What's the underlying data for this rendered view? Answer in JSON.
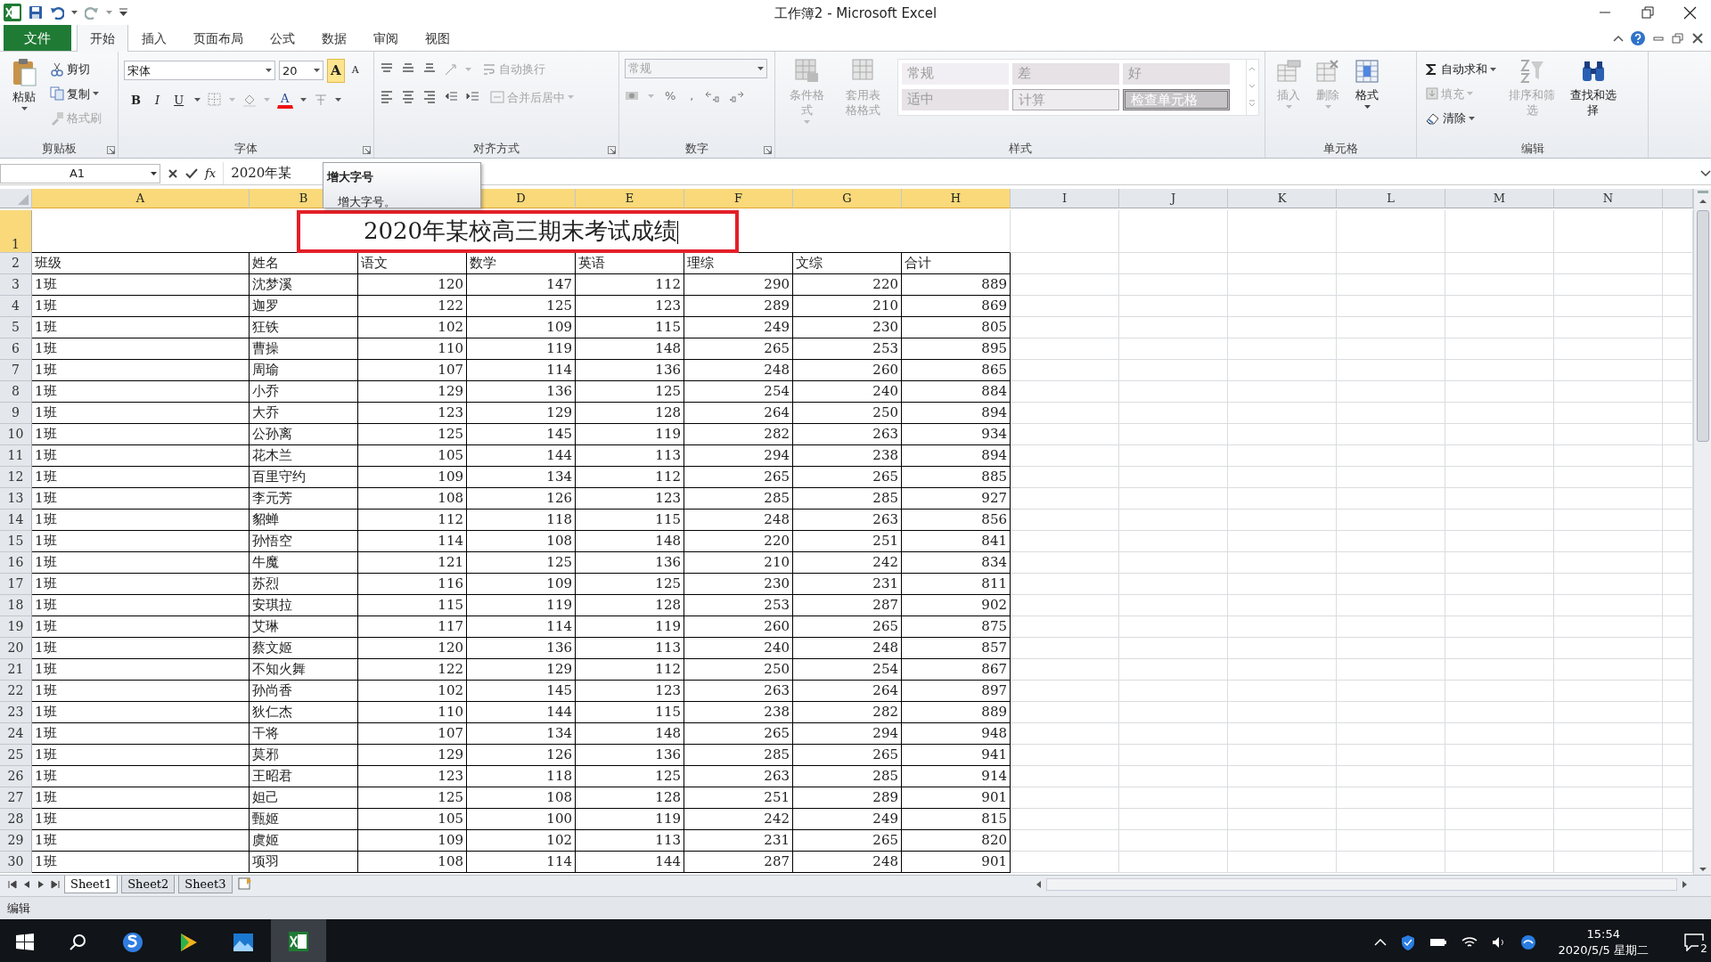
{
  "window": {
    "title": "工作簿2 - Microsoft Excel"
  },
  "ribbon_tabs": [
    {
      "label": "文件",
      "kind": "file",
      "selected": false
    },
    {
      "label": "开始",
      "kind": "tab",
      "selected": true
    },
    {
      "label": "插入",
      "kind": "tab",
      "selected": false
    },
    {
      "label": "页面布局",
      "kind": "tab",
      "selected": false
    },
    {
      "label": "公式",
      "kind": "tab",
      "selected": false
    },
    {
      "label": "数据",
      "kind": "tab",
      "selected": false
    },
    {
      "label": "审阅",
      "kind": "tab",
      "selected": false
    },
    {
      "label": "视图",
      "kind": "tab",
      "selected": false
    }
  ],
  "ribbon": {
    "groups": [
      {
        "kind": "clipboard",
        "label": "剪贴板",
        "launcher": true,
        "buttons": [
          {
            "label": "粘贴",
            "disabled": false
          },
          {
            "label": "剪切",
            "disabled": false
          },
          {
            "label": "复制",
            "disabled": false
          },
          {
            "label": "格式刷",
            "disabled": true
          }
        ]
      },
      {
        "kind": "font",
        "label": "字体",
        "launcher": true,
        "font_name": "宋体",
        "font_size": "20",
        "buttons": [
          {
            "label": "A",
            "highlighted": true
          },
          {
            "label": "A",
            "highlighted": false
          },
          {
            "label": "B",
            "highlighted": false
          },
          {
            "label": "I",
            "highlighted": false
          },
          {
            "label": "U",
            "highlighted": false
          },
          {
            "label": "A",
            "highlighted": false
          }
        ]
      },
      {
        "kind": "alignment",
        "label": "对齐方式",
        "launcher": true,
        "buttons": [
          {
            "label": "自动换行",
            "disabled": true
          },
          {
            "label": "合并后居中",
            "disabled": true
          }
        ]
      },
      {
        "kind": "number",
        "label": "数字",
        "launcher": true,
        "format": {
          "value": "常规",
          "disabled": true
        },
        "symbols": [
          "%",
          ","
        ]
      },
      {
        "kind": "styles",
        "label": "样式",
        "buttons": [
          {
            "label": "条件格式",
            "disabled": true
          },
          {
            "label": "套用表格格式",
            "disabled": true
          }
        ],
        "styles": [
          {
            "label": "常规",
            "kind": "normal"
          },
          {
            "label": "差",
            "kind": "bad"
          },
          {
            "label": "好",
            "kind": "good"
          },
          {
            "label": "适中",
            "kind": "neutral"
          },
          {
            "label": "计算",
            "kind": "calc"
          },
          {
            "label": "检查单元格",
            "kind": "check"
          }
        ]
      },
      {
        "kind": "cells",
        "label": "单元格",
        "buttons": [
          {
            "label": "插入",
            "disabled": true
          },
          {
            "label": "删除",
            "disabled": true
          },
          {
            "label": "格式",
            "disabled": false
          }
        ]
      },
      {
        "kind": "editing",
        "label": "编辑",
        "buttons": [
          {
            "label": "自动求和",
            "disabled": false
          },
          {
            "label": "填充",
            "disabled": true
          },
          {
            "label": "清除",
            "disabled": false
          },
          {
            "label": "排序和筛选",
            "disabled": true
          },
          {
            "label": "查找和选择",
            "disabled": false
          }
        ]
      }
    ]
  },
  "formula_bar": {
    "name_box": "A1",
    "fx": "fx",
    "content": "2020年某"
  },
  "tooltip": {
    "title": "增大字号",
    "text": "增大字号。"
  },
  "columns": [
    {
      "label": "A",
      "selected": true
    },
    {
      "label": "B",
      "selected": true
    },
    {
      "label": "D",
      "selected": true
    },
    {
      "label": "E",
      "selected": true
    },
    {
      "label": "F",
      "selected": true
    },
    {
      "label": "G",
      "selected": true
    },
    {
      "label": "H",
      "selected": true
    },
    {
      "label": "I",
      "selected": false
    },
    {
      "label": "J",
      "selected": false
    },
    {
      "label": "K",
      "selected": false
    },
    {
      "label": "L",
      "selected": false
    },
    {
      "label": "M",
      "selected": false
    },
    {
      "label": "N",
      "selected": false
    }
  ],
  "rows": [
    {
      "row": "1",
      "kind": "title",
      "selected": true,
      "cells": [
        "2020年某校高三期末考试成绩"
      ]
    },
    {
      "row": "2",
      "kind": "header",
      "selected": false,
      "cells": [
        "班级",
        "姓名",
        "语文",
        "数学",
        "英语",
        "理综",
        "文综",
        "合计"
      ]
    },
    {
      "row": "3",
      "kind": "data",
      "selected": false,
      "cells": [
        "1班",
        "沈梦溪",
        "120",
        "147",
        "112",
        "290",
        "220",
        "889"
      ]
    },
    {
      "row": "4",
      "kind": "data",
      "selected": false,
      "cells": [
        "1班",
        "迦罗",
        "122",
        "125",
        "123",
        "289",
        "210",
        "869"
      ]
    },
    {
      "row": "5",
      "kind": "data",
      "selected": false,
      "cells": [
        "1班",
        "狂铁",
        "102",
        "109",
        "115",
        "249",
        "230",
        "805"
      ]
    },
    {
      "row": "6",
      "kind": "data",
      "selected": false,
      "cells": [
        "1班",
        "曹操",
        "110",
        "119",
        "148",
        "265",
        "253",
        "895"
      ]
    },
    {
      "row": "7",
      "kind": "data",
      "selected": false,
      "cells": [
        "1班",
        "周瑜",
        "107",
        "114",
        "136",
        "248",
        "260",
        "865"
      ]
    },
    {
      "row": "8",
      "kind": "data",
      "selected": false,
      "cells": [
        "1班",
        "小乔",
        "129",
        "136",
        "125",
        "254",
        "240",
        "884"
      ]
    },
    {
      "row": "9",
      "kind": "data",
      "selected": false,
      "cells": [
        "1班",
        "大乔",
        "123",
        "129",
        "128",
        "264",
        "250",
        "894"
      ]
    },
    {
      "row": "10",
      "kind": "data",
      "selected": false,
      "cells": [
        "1班",
        "公孙离",
        "125",
        "145",
        "119",
        "282",
        "263",
        "934"
      ]
    },
    {
      "row": "11",
      "kind": "data",
      "selected": false,
      "cells": [
        "1班",
        "花木兰",
        "105",
        "144",
        "113",
        "294",
        "238",
        "894"
      ]
    },
    {
      "row": "12",
      "kind": "data",
      "selected": false,
      "cells": [
        "1班",
        "百里守约",
        "109",
        "134",
        "112",
        "265",
        "265",
        "885"
      ]
    },
    {
      "row": "13",
      "kind": "data",
      "selected": false,
      "cells": [
        "1班",
        "李元芳",
        "108",
        "126",
        "123",
        "285",
        "285",
        "927"
      ]
    },
    {
      "row": "14",
      "kind": "data",
      "selected": false,
      "cells": [
        "1班",
        "貂蝉",
        "112",
        "118",
        "115",
        "248",
        "263",
        "856"
      ]
    },
    {
      "row": "15",
      "kind": "data",
      "selected": false,
      "cells": [
        "1班",
        "孙悟空",
        "114",
        "108",
        "148",
        "220",
        "251",
        "841"
      ]
    },
    {
      "row": "16",
      "kind": "data",
      "selected": false,
      "cells": [
        "1班",
        "牛魔",
        "121",
        "125",
        "136",
        "210",
        "242",
        "834"
      ]
    },
    {
      "row": "17",
      "kind": "data",
      "selected": false,
      "cells": [
        "1班",
        "苏烈",
        "116",
        "109",
        "125",
        "230",
        "231",
        "811"
      ]
    },
    {
      "row": "18",
      "kind": "data",
      "selected": false,
      "cells": [
        "1班",
        "安琪拉",
        "115",
        "119",
        "128",
        "253",
        "287",
        "902"
      ]
    },
    {
      "row": "19",
      "kind": "data",
      "selected": false,
      "cells": [
        "1班",
        "艾琳",
        "117",
        "114",
        "119",
        "260",
        "265",
        "875"
      ]
    },
    {
      "row": "20",
      "kind": "data",
      "selected": false,
      "cells": [
        "1班",
        "蔡文姬",
        "120",
        "136",
        "113",
        "240",
        "248",
        "857"
      ]
    },
    {
      "row": "21",
      "kind": "data",
      "selected": false,
      "cells": [
        "1班",
        "不知火舞",
        "122",
        "129",
        "112",
        "250",
        "254",
        "867"
      ]
    },
    {
      "row": "22",
      "kind": "data",
      "selected": false,
      "cells": [
        "1班",
        "孙尚香",
        "102",
        "145",
        "123",
        "263",
        "264",
        "897"
      ]
    },
    {
      "row": "23",
      "kind": "data",
      "selected": false,
      "cells": [
        "1班",
        "狄仁杰",
        "110",
        "144",
        "115",
        "238",
        "282",
        "889"
      ]
    },
    {
      "row": "24",
      "kind": "data",
      "selected": false,
      "cells": [
        "1班",
        "干将",
        "107",
        "134",
        "148",
        "265",
        "294",
        "948"
      ]
    },
    {
      "row": "25",
      "kind": "data",
      "selected": false,
      "cells": [
        "1班",
        "莫邪",
        "129",
        "126",
        "136",
        "285",
        "265",
        "941"
      ]
    },
    {
      "row": "26",
      "kind": "data",
      "selected": false,
      "cells": [
        "1班",
        "王昭君",
        "123",
        "118",
        "125",
        "263",
        "285",
        "914"
      ]
    },
    {
      "row": "27",
      "kind": "data",
      "selected": false,
      "cells": [
        "1班",
        "妲己",
        "125",
        "108",
        "128",
        "251",
        "289",
        "901"
      ]
    },
    {
      "row": "28",
      "kind": "data",
      "selected": false,
      "cells": [
        "1班",
        "甄姬",
        "105",
        "100",
        "119",
        "242",
        "249",
        "815"
      ]
    },
    {
      "row": "29",
      "kind": "data",
      "selected": false,
      "cells": [
        "1班",
        "虞姬",
        "109",
        "102",
        "113",
        "231",
        "265",
        "820"
      ]
    },
    {
      "row": "30",
      "kind": "data",
      "selected": false,
      "cells": [
        "1班",
        "项羽",
        "108",
        "114",
        "144",
        "287",
        "248",
        "901"
      ]
    }
  ],
  "sheet_tabs": [
    {
      "label": "Sheet1",
      "selected": true
    },
    {
      "label": "Sheet2",
      "selected": false
    },
    {
      "label": "Sheet3",
      "selected": false
    }
  ],
  "status_bar": {
    "mode": "编辑"
  },
  "taskbar": {
    "time": "15:54",
    "date": "2020/5/5 星期二",
    "notifications": "2"
  }
}
